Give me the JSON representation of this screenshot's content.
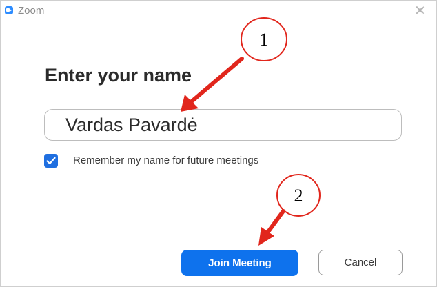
{
  "window": {
    "title": "Zoom",
    "app_icon": "zoom-camera-icon",
    "close_icon": "close-icon"
  },
  "dialog": {
    "heading": "Enter your name",
    "name_input": {
      "value": "Vardas Pavardė",
      "placeholder": ""
    },
    "remember_checkbox": {
      "checked": true,
      "label": "Remember my name for future meetings"
    },
    "buttons": {
      "join_label": "Join Meeting",
      "cancel_label": "Cancel"
    }
  },
  "annotations": [
    {
      "number": "1",
      "color": "#e1261c"
    },
    {
      "number": "2",
      "color": "#e1261c"
    }
  ],
  "colors": {
    "accent": "#0e72ed",
    "checkbox": "#1f6fe0",
    "annotation": "#e1261c"
  }
}
